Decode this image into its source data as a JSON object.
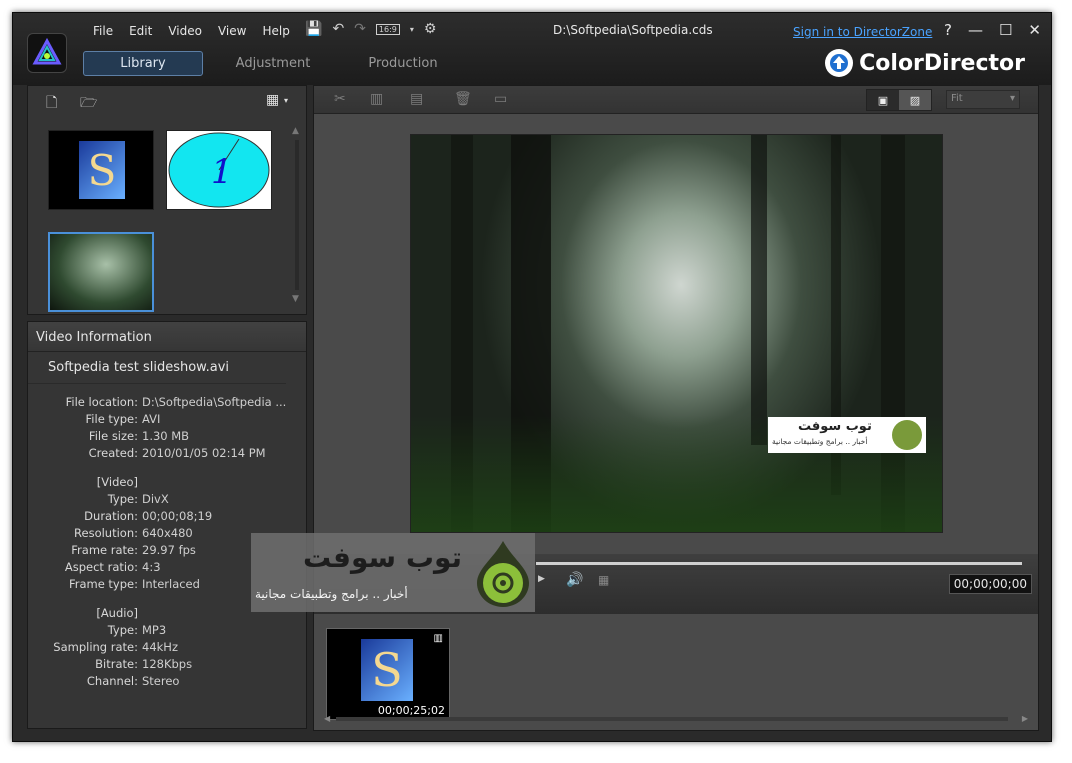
{
  "window": {
    "file_title": "D:\\Softpedia\\Softpedia.cds",
    "signin_link": "Sign in to DirectorZone",
    "brand": "ColorDirector",
    "menu": [
      "File",
      "Edit",
      "Video",
      "View",
      "Help"
    ],
    "ratio_label": "16:9",
    "win_help": "?",
    "win_min": "—",
    "win_max": "☐",
    "win_close": "✕"
  },
  "tabs": [
    {
      "label": "Library",
      "active": true
    },
    {
      "label": "Adjustment",
      "active": false
    },
    {
      "label": "Production",
      "active": false
    }
  ],
  "info": {
    "header": "Video Information",
    "filename": "Softpedia test slideshow.avi",
    "general": [
      {
        "k": "File location:",
        "v": "D:\\Softpedia\\Softpedia ..."
      },
      {
        "k": "File type:",
        "v": "AVI"
      },
      {
        "k": "File size:",
        "v": "1.30 MB"
      },
      {
        "k": "Created:",
        "v": "2010/01/05 02:14 PM"
      }
    ],
    "video_header": "[Video]",
    "video": [
      {
        "k": "Type:",
        "v": "DivX"
      },
      {
        "k": "Duration:",
        "v": "00;00;08;19"
      },
      {
        "k": "Resolution:",
        "v": "640x480"
      },
      {
        "k": "Frame rate:",
        "v": "29.97 fps"
      },
      {
        "k": "Aspect ratio:",
        "v": "4:3"
      },
      {
        "k": "Frame type:",
        "v": "Interlaced"
      }
    ],
    "audio_header": "[Audio]",
    "audio": [
      {
        "k": "Type:",
        "v": "MP3"
      },
      {
        "k": "Sampling rate:",
        "v": "44kHz"
      },
      {
        "k": "Bitrate:",
        "v": "128Kbps"
      },
      {
        "k": "Channel:",
        "v": "Stereo"
      }
    ]
  },
  "preview": {
    "fit_label": "Fit",
    "timecode": "00;00;00;00",
    "logo_badge_title": "توب سوفت",
    "logo_badge_sub": "أخبار .. برامج وتطبيقات مجانية"
  },
  "timeline": {
    "clip_time": "00;00;25;02"
  },
  "watermark": {
    "title": "توب سوفت",
    "subtitle": "أخبار .. برامج وتطبيقات مجانية"
  },
  "colors": {
    "accent_blue": "#4aa3ff",
    "tab_active_bg": "#243a52",
    "volume_red": "#dd4a3a"
  }
}
